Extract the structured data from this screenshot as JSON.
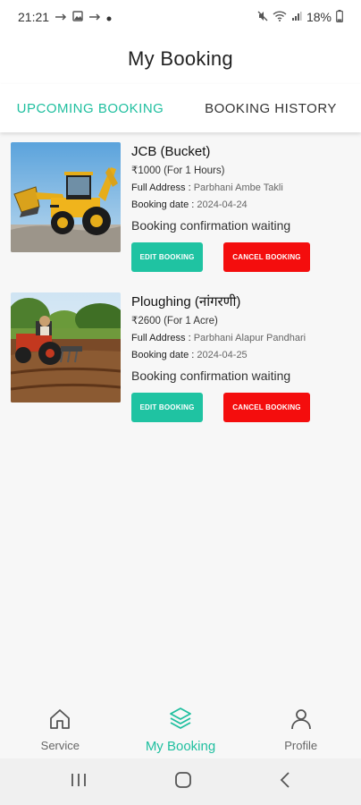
{
  "status_bar": {
    "time": "21:21",
    "battery": "18%"
  },
  "header": {
    "title": "My Booking"
  },
  "tabs": [
    {
      "label": "UPCOMING BOOKING",
      "active": true
    },
    {
      "label": "BOOKING HISTORY",
      "active": false
    }
  ],
  "bookings": [
    {
      "title": "JCB (Bucket)",
      "price": "₹1000 (For 1 Hours)",
      "address_label": "Full Address :",
      "address": "Parbhani Ambe Takli",
      "date_label": "Booking date :",
      "date": "2024-04-24",
      "status": "Booking confirmation waiting",
      "edit_label": "EDIT BOOKING",
      "cancel_label": "CANCEL BOOKING"
    },
    {
      "title": "Ploughing (नांगरणी)",
      "price": "₹2600 (For 1 Acre)",
      "address_label": "Full Address :",
      "address": "Parbhani Alapur Pandhari",
      "date_label": "Booking date :",
      "date": "2024-04-25",
      "status": "Booking confirmation waiting",
      "edit_label": "EDIT BOOKING",
      "cancel_label": "CANCEL BOOKING"
    }
  ],
  "bottom_nav": [
    {
      "label": "Service",
      "icon": "home-icon",
      "active": false
    },
    {
      "label": "My Booking",
      "icon": "layers-icon",
      "active": true
    },
    {
      "label": "Profile",
      "icon": "person-icon",
      "active": false
    }
  ],
  "colors": {
    "accent": "#1fbf9f",
    "edit_button": "#1fc3a2",
    "cancel_button": "#f40d0d"
  }
}
